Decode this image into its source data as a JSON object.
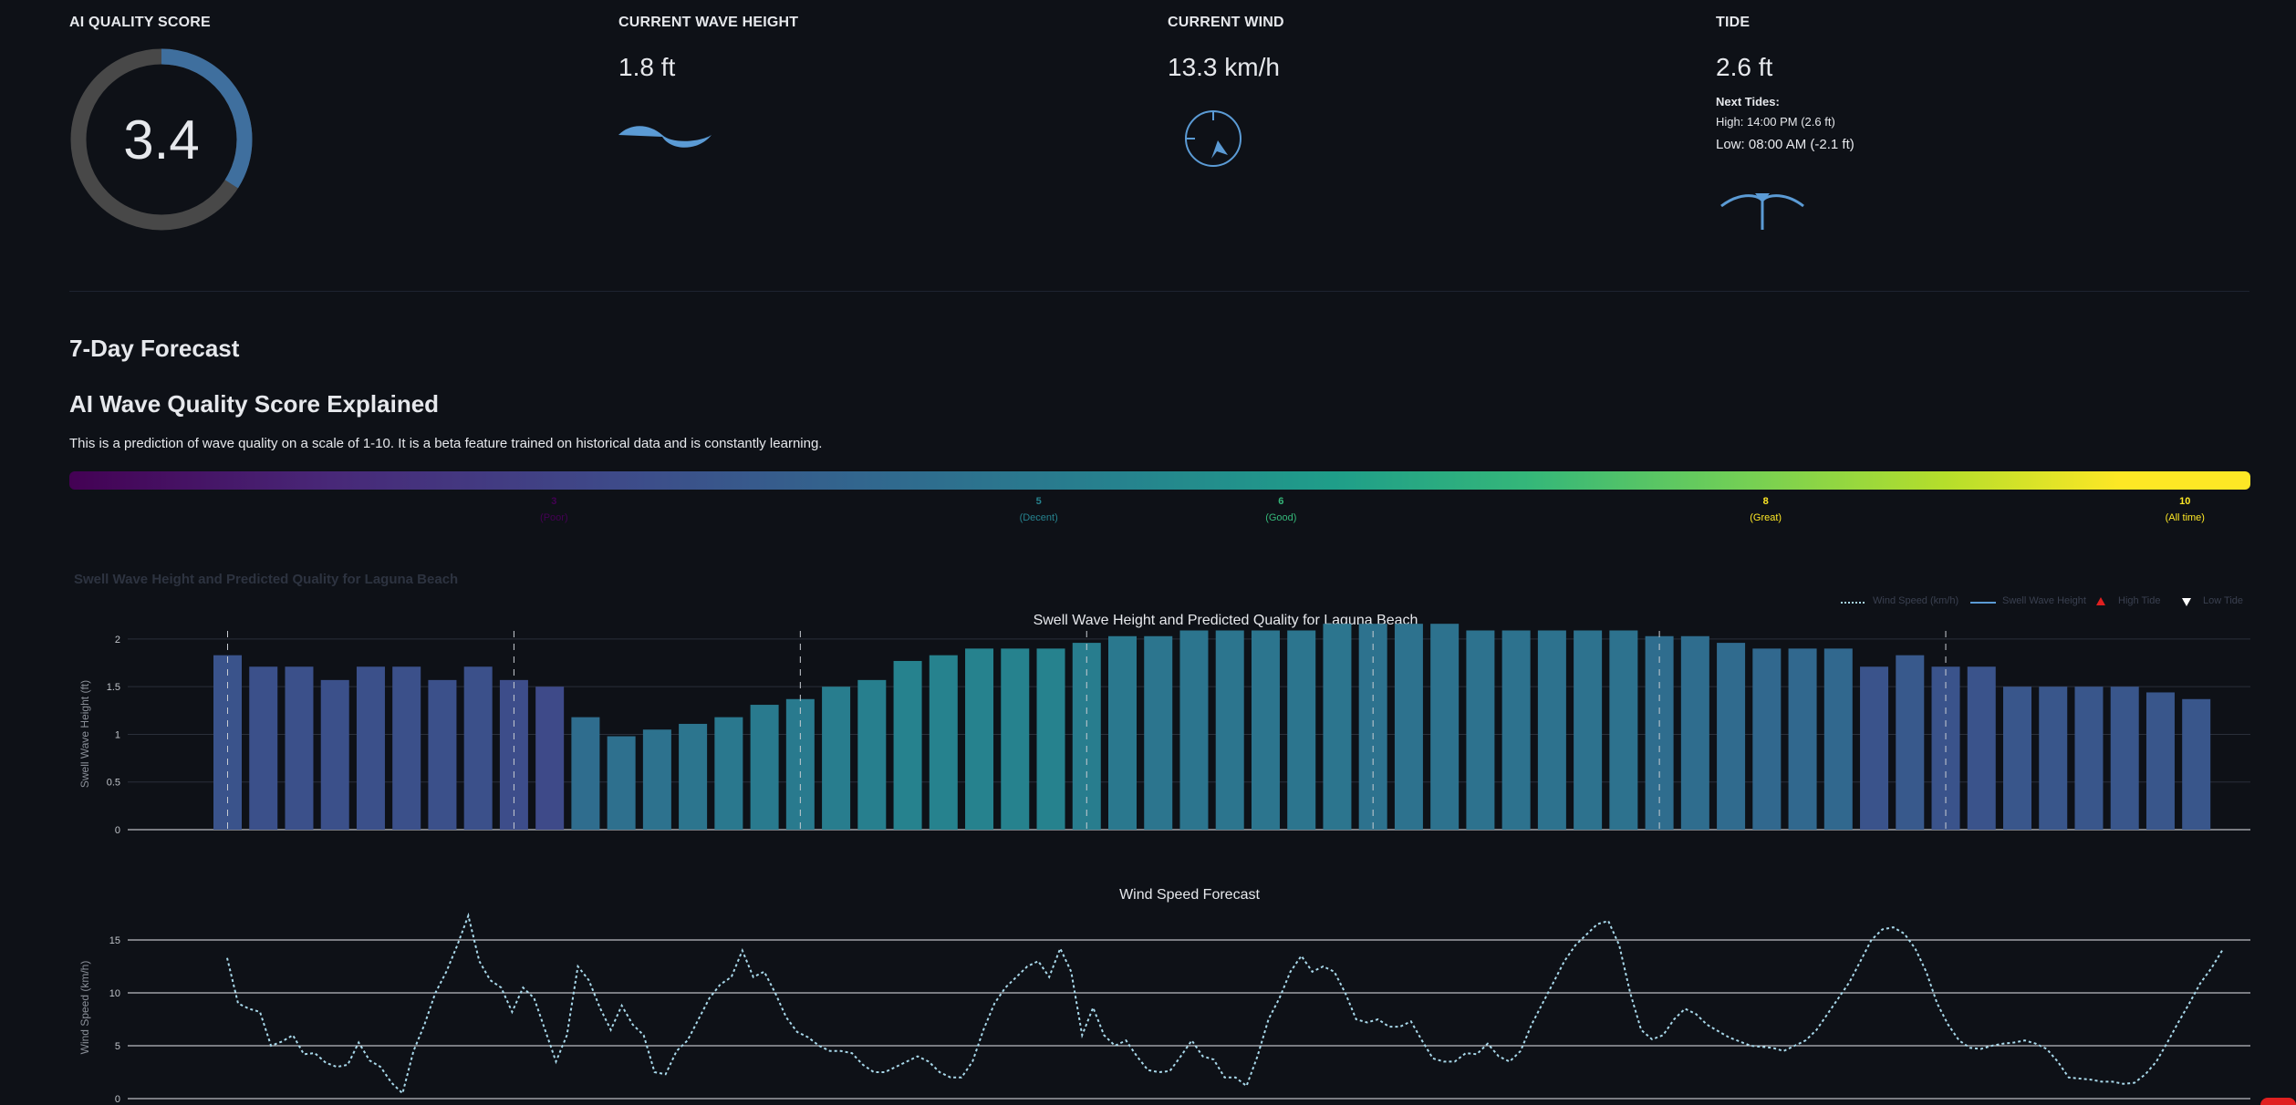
{
  "metrics": {
    "quality": {
      "label": "AI QUALITY SCORE",
      "value": "3.4",
      "score": 3.4,
      "max": 10
    },
    "wave": {
      "label": "CURRENT WAVE HEIGHT",
      "value": "1.8 ft",
      "icon": "wave-icon"
    },
    "wind": {
      "label": "CURRENT WIND",
      "value": "13.3 km/h",
      "icon": "wind-compass-icon"
    },
    "tide": {
      "label": "TIDE",
      "value": "2.6 ft",
      "next_label": "Next Tides:",
      "high": "High: 14:00 PM (2.6 ft)",
      "low": "Low: 08:00 AM (-2.1 ft)",
      "icon": "tide-icon"
    }
  },
  "forecast_heading": "7-Day Forecast",
  "explainer": {
    "heading": "AI Wave Quality Score Explained",
    "description": "This is a prediction of wave quality on a scale of 1-10. It is a beta feature trained on historical data and is constantly learning.",
    "scale": [
      {
        "num": "3",
        "label": "(Poor)",
        "color": "#440154"
      },
      {
        "num": "5",
        "label": "(Decent)",
        "color": "#26828e"
      },
      {
        "num": "6",
        "label": "(Good)",
        "color": "#35b779"
      },
      {
        "num": "8",
        "label": "(Great)",
        "color": "#fde725"
      },
      {
        "num": "10",
        "label": "(All time)",
        "color": "#fde725"
      }
    ]
  },
  "chart_section_title": "Swell Wave Height and Predicted Quality for Laguna Beach",
  "legend": {
    "wind": "Wind Speed (km/h)",
    "wave": "Swell Wave Height",
    "high": "High Tide",
    "low": "Low Tide"
  },
  "colors": {
    "background": "#0e1117",
    "accent": "#5b9bd5",
    "wind_line": "#a8d8ea",
    "high_tide": "#e02020"
  },
  "chart_data": [
    {
      "type": "bar",
      "title": "Swell Wave Height and Predicted Quality for Laguna Beach",
      "xlabel": "",
      "ylabel": "Swell Wave Height (ft)",
      "ylim": [
        0,
        2.2
      ],
      "yticks": [
        0,
        0.5,
        1,
        1.5,
        2
      ],
      "values": [
        1.83,
        1.71,
        1.71,
        1.57,
        1.71,
        1.71,
        1.57,
        1.71,
        1.57,
        1.5,
        1.18,
        0.98,
        1.05,
        1.11,
        1.18,
        1.31,
        1.37,
        1.5,
        1.57,
        1.77,
        1.83,
        1.9,
        1.9,
        1.9,
        1.96,
        2.03,
        2.03,
        2.09,
        2.09,
        2.09,
        2.09,
        2.16,
        2.16,
        2.16,
        2.16,
        2.09,
        2.09,
        2.09,
        2.09,
        2.09,
        2.03,
        2.03,
        1.96,
        1.9,
        1.9,
        1.9,
        1.71,
        1.83,
        1.71,
        1.71,
        1.5,
        1.5,
        1.5,
        1.5,
        1.44,
        1.37
      ],
      "quality": [
        3.3,
        3.2,
        3.2,
        3.2,
        3.2,
        3.2,
        3.2,
        3.2,
        3.1,
        3.0,
        4.2,
        4.3,
        4.4,
        4.5,
        4.6,
        4.7,
        4.7,
        4.8,
        4.9,
        5.0,
        5.0,
        5.0,
        5.0,
        5.0,
        4.8,
        4.6,
        4.5,
        4.5,
        4.5,
        4.5,
        4.5,
        4.5,
        4.4,
        4.4,
        4.4,
        4.4,
        4.4,
        4.4,
        4.4,
        4.4,
        4.2,
        4.2,
        4.1,
        4.0,
        4.0,
        4.0,
        3.3,
        3.5,
        3.3,
        3.3,
        3.4,
        3.4,
        3.4,
        3.4,
        3.4,
        3.4
      ],
      "high_tide_marks": [
        0,
        8,
        16,
        24,
        32,
        40,
        48
      ],
      "grid": true,
      "legend": "top-right"
    },
    {
      "type": "line",
      "title": "Wind Speed Forecast",
      "xlabel": "",
      "ylabel": "Wind Speed (km/h)",
      "ylim": [
        0,
        18
      ],
      "yticks": [
        0,
        5,
        10,
        15
      ],
      "name": "Wind Speed (km/h)",
      "values": [
        13.3,
        9,
        8.5,
        8.2,
        5,
        5.4,
        6,
        4.2,
        4.3,
        3.4,
        3,
        3.2,
        5.3,
        3.6,
        3,
        1.5,
        0.5,
        4.5,
        7,
        10,
        12,
        14.5,
        17.3,
        13,
        11.2,
        10.5,
        8.2,
        10.5,
        9.5,
        6.5,
        3.5,
        6,
        12.5,
        11.2,
        8.6,
        6.5,
        8.8,
        7,
        6,
        2.5,
        2.3,
        4.5,
        5.5,
        7.5,
        9.5,
        10.8,
        11.5,
        14,
        11.5,
        12,
        10,
        7.7,
        6.3,
        5.8,
        5,
        4.5,
        4.5,
        4.3,
        3.2,
        2.5,
        2.5,
        3,
        3.5,
        4,
        3.5,
        2.5,
        2,
        2,
        3.5,
        6.5,
        9,
        10.5,
        11.5,
        12.5,
        13,
        11.5,
        14.2,
        12,
        6,
        8.6,
        6,
        5,
        5.5,
        4,
        2.7,
        2.5,
        2.6,
        4,
        5.5,
        4,
        3.7,
        2,
        2,
        1.2,
        4,
        7.5,
        9.5,
        12,
        13.5,
        12,
        12.5,
        12,
        10,
        7.5,
        7.2,
        7.5,
        6.8,
        6.8,
        7.3,
        5.5,
        3.8,
        3.5,
        3.5,
        4.3,
        4.2,
        5.2,
        4,
        3.5,
        4.5,
        7,
        9,
        11,
        13,
        14.5,
        15.5,
        16.5,
        16.8,
        14.5,
        10,
        6.5,
        5.6,
        6,
        7.5,
        8.5,
        8,
        7,
        6.4,
        5.8,
        5.4,
        5,
        4.9,
        4.8,
        4.5,
        5,
        5.5,
        6.5,
        8,
        9.5,
        11,
        13,
        15,
        16,
        16.2,
        15.6,
        14.2,
        12,
        9,
        7,
        5.5,
        4.8,
        4.7,
        5,
        5.2,
        5.3,
        5.5,
        5.2,
        4.7,
        3.5,
        2,
        1.9,
        1.8,
        1.6,
        1.6,
        1.4,
        1.5,
        2.3,
        3.5,
        5.3,
        7.2,
        9,
        10.9,
        12.3,
        14
      ],
      "grid": true
    }
  ]
}
